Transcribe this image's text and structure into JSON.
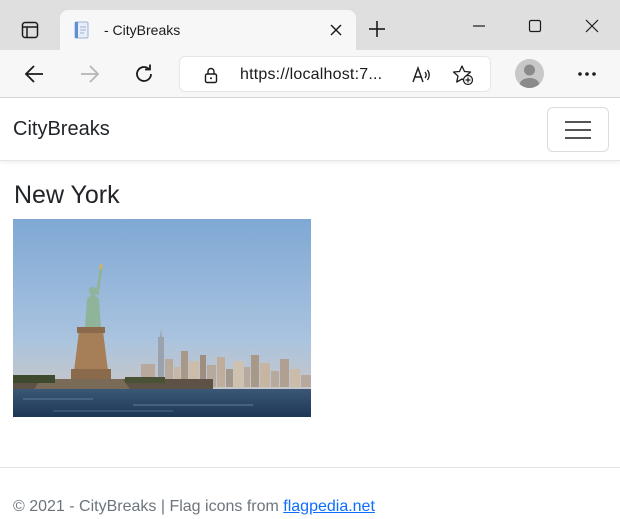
{
  "browser": {
    "tab": {
      "title": " - CityBreaks"
    },
    "address": {
      "url": "https://localhost:7..."
    },
    "colors": {
      "tabstrip": "#dfdfdf",
      "toolbar": "#f7f7f7"
    }
  },
  "site": {
    "brand": "CityBreaks",
    "heading": "New York",
    "photo_icon": "statue-of-liberty-skyline-photo",
    "footer": {
      "prefix": "© 2021 - CityBreaks | Flag icons from ",
      "link_text": "flagpedia.net"
    },
    "colors": {
      "link": "#0d6efd",
      "muted": "#6c757d",
      "text": "#212529"
    }
  }
}
